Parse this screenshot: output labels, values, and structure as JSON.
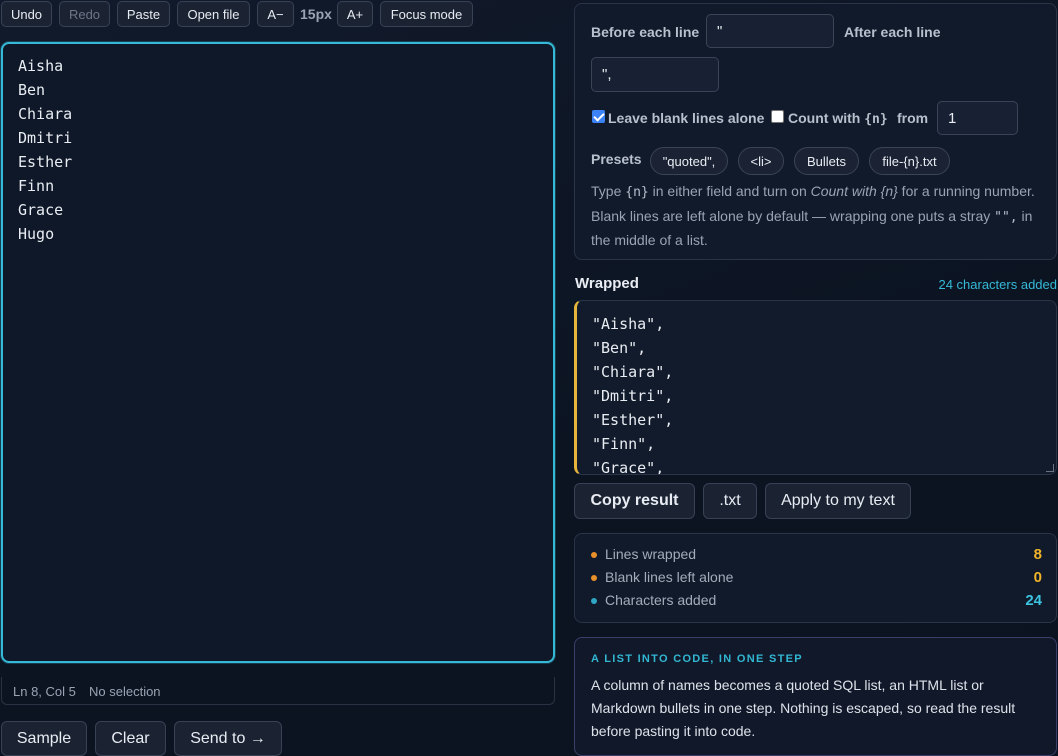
{
  "toolbar": {
    "undo": "Undo",
    "redo": "Redo",
    "paste": "Paste",
    "open_file": "Open file",
    "font_smaller": "A−",
    "font_size": "15px",
    "font_larger": "A+",
    "focus_mode": "Focus mode"
  },
  "editor": {
    "lines": [
      "Aisha",
      "Ben",
      "Chiara",
      "Dmitri",
      "Esther",
      "Finn",
      "Grace",
      "Hugo"
    ],
    "cursor": "Ln 8, Col 5",
    "selection": "No selection"
  },
  "actions": {
    "sample": "Sample",
    "clear": "Clear",
    "send_to": "Send to →"
  },
  "options": {
    "before_label": "Before each line",
    "before_value": "\"",
    "after_label": "After each line",
    "after_value": "\",",
    "leave_blank_label": "Leave blank lines alone",
    "leave_blank_checked": true,
    "count_label_prefix": "Count with ",
    "count_token": "{n}",
    "count_checked": false,
    "from_label": "from",
    "from_value": "1",
    "presets_label": "Presets",
    "presets": [
      "\"quoted\",",
      "<li>",
      "Bullets",
      "file-{n}.txt"
    ],
    "help": {
      "p1": "Type ",
      "token1": "{n}",
      "p2": " in either field and turn on ",
      "em": "Count with {n}",
      "p3": " for a running number. Blank lines are left alone by default — wrapping one puts a stray ",
      "token2": "\"\",",
      "p4": " in the middle of a list."
    }
  },
  "result": {
    "title": "Wrapped",
    "added_note": "24 characters added",
    "lines": [
      "\"Aisha\",",
      "\"Ben\",",
      "\"Chiara\",",
      "\"Dmitri\",",
      "\"Esther\",",
      "\"Finn\",",
      "\"Grace\","
    ],
    "copy": "Copy result",
    "txt": ".txt",
    "apply": "Apply to my text"
  },
  "stats": [
    {
      "label": "Lines wrapped",
      "value": "8",
      "color": "#e8902c",
      "value_color": "#f0b429"
    },
    {
      "label": "Blank lines left alone",
      "value": "0",
      "color": "#e8902c",
      "value_color": "#f0b429"
    },
    {
      "label": "Characters added",
      "value": "24",
      "color": "#2fa7c4",
      "value_color": "#3cc3e0"
    }
  ],
  "tip": {
    "heading": "A LIST INTO CODE, IN ONE STEP",
    "body": "A column of names becomes a quoted SQL list, an HTML list or Markdown bullets in one step. Nothing is escaped, so read the result before pasting it into code."
  },
  "colors": {
    "accent": "#35b9d6",
    "result_accent": "#e7b53c",
    "checkbox": "#3b82f6"
  }
}
